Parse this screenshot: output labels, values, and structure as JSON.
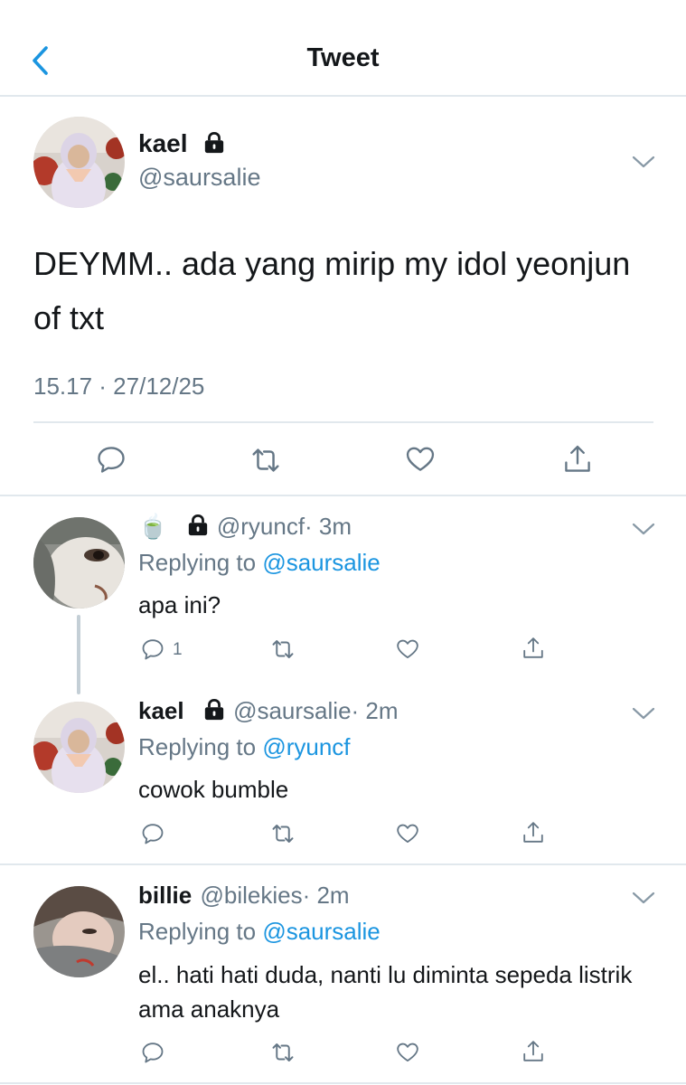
{
  "header": {
    "title": "Tweet"
  },
  "main_tweet": {
    "name": "kael",
    "handle": "@saursalie",
    "text": "DEYMM.. ada yang mirip my idol yeonjun of txt",
    "timestamp": "15.17 · 27/12/25"
  },
  "replies": [
    {
      "name": "🍵",
      "handle": "@ryuncf",
      "time": "· 3m",
      "replying_label": "Replying to",
      "replying_to": "@saursalie",
      "text": "apa ini?",
      "reply_count": "1"
    },
    {
      "name": "kael",
      "handle": "@saursalie",
      "time": "· 2m",
      "replying_label": "Replying to",
      "replying_to": "@ryuncf",
      "text": "cowok bumble"
    },
    {
      "name": "billie",
      "handle": "@bilekies",
      "time": "· 2m",
      "replying_label": "Replying to",
      "replying_to": "@saursalie",
      "text": "el.. hati hati duda, nanti lu diminta sepeda listrik ama anaknya"
    }
  ],
  "colors": {
    "link": "#1b95e0",
    "muted": "#657786",
    "divider": "#e1e8ed",
    "icon": "#657786"
  }
}
